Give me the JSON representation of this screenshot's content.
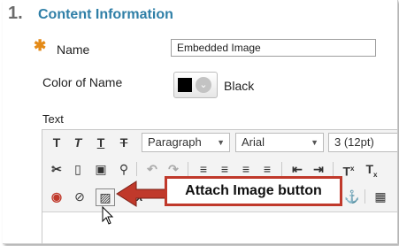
{
  "section": {
    "number": "1.",
    "title": "Content Information"
  },
  "name_field": {
    "required_mark": "✱",
    "label": "Name",
    "value": "Embedded Image"
  },
  "color_field": {
    "label": "Color of Name",
    "swatch_color": "#000000",
    "value": "Black"
  },
  "text_field": {
    "label": "Text"
  },
  "editor": {
    "format_select": "Paragraph",
    "font_select": "Arial",
    "size_select": "3 (12pt)",
    "row1_icons": [
      "bold-icon",
      "italic-icon",
      "underline-icon",
      "strikethrough-icon"
    ],
    "row2_icons": [
      "cut-icon",
      "copy-icon",
      "paste-icon",
      "find-icon",
      "undo-icon",
      "redo-icon",
      "align-left-icon",
      "align-center-icon",
      "align-right-icon",
      "justify-icon",
      "outdent-icon",
      "indent-icon",
      "superscript-icon",
      "subscript-icon"
    ],
    "row3_icons": [
      "record-icon",
      "attach-file-icon",
      "attach-image-icon",
      "media-icon",
      "math-icon",
      "anchor-icon",
      "table-icon"
    ]
  },
  "callout": {
    "text": "Attach Image button",
    "color": "#c0392b"
  },
  "colors": {
    "accent": "#2f7fa7",
    "required": "#e48a17"
  }
}
